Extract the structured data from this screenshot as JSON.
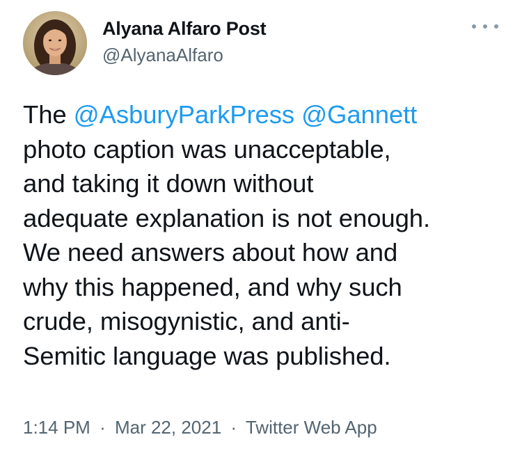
{
  "author": {
    "display_name": "Alyana Alfaro Post",
    "handle": "@AlyanaAlfaro"
  },
  "tweet": {
    "lines": [
      [
        {
          "text": "The ",
          "mention": false
        },
        {
          "text": "@AsburyParkPress",
          "mention": true
        },
        {
          "text": " ",
          "mention": false
        },
        {
          "text": "@Gannett",
          "mention": true
        }
      ],
      [
        {
          "text": "photo caption was unacceptable,",
          "mention": false
        }
      ],
      [
        {
          "text": "and taking it down without",
          "mention": false
        }
      ],
      [
        {
          "text": "adequate explanation is not enough.",
          "mention": false
        }
      ],
      [
        {
          "text": "We need answers about how and",
          "mention": false
        }
      ],
      [
        {
          "text": "why this happened, and why such",
          "mention": false
        }
      ],
      [
        {
          "text": "crude, misogynistic, and anti-",
          "mention": false
        }
      ],
      [
        {
          "text": "Semitic language was published.",
          "mention": false
        }
      ]
    ]
  },
  "meta": {
    "time": "1:14 PM",
    "separator": "·",
    "date": "Mar 22, 2021",
    "source": "Twitter Web App"
  },
  "colors": {
    "mention": "#1d9bf0",
    "secondary_text": "#536471",
    "primary_text": "#0f1419"
  },
  "icons": {
    "more": "more-horizontal-icon"
  }
}
